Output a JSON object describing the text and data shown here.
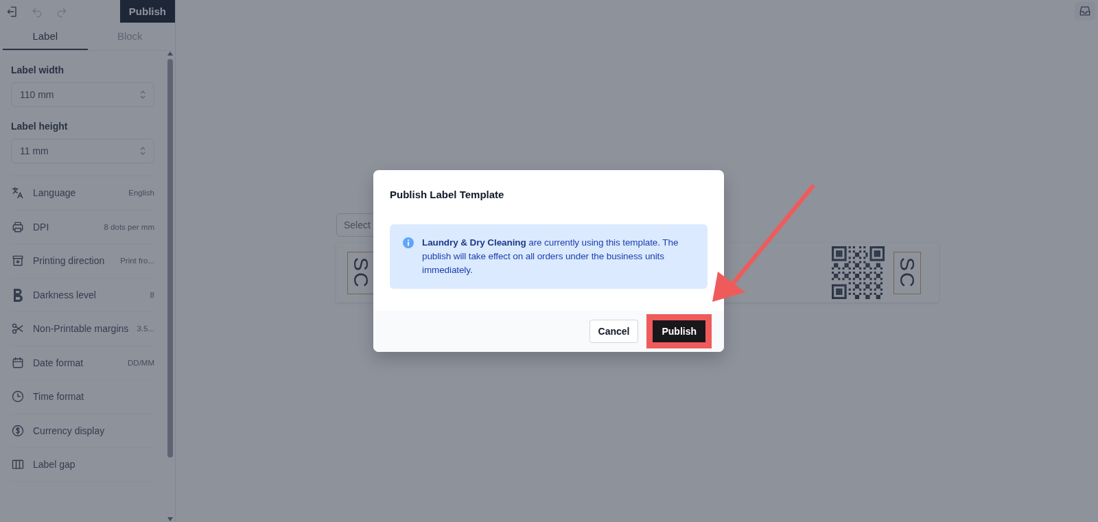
{
  "toolbar": {
    "publish_button": "Publish"
  },
  "tabs": [
    {
      "label": "Label",
      "selected": true
    },
    {
      "label": "Block",
      "selected": false
    }
  ],
  "fields": [
    {
      "label": "Label width",
      "value": "110 mm"
    },
    {
      "label": "Label height",
      "value": "11 mm"
    }
  ],
  "settings": [
    {
      "label": "Language",
      "value": "English"
    },
    {
      "label": "DPI",
      "value": "8 dots per mm"
    },
    {
      "label": "Printing direction",
      "value": "Print fro..."
    },
    {
      "label": "Darkness level",
      "value": "8"
    },
    {
      "label": "Non-Printable margins",
      "value": "3.5..."
    },
    {
      "label": "Date format",
      "value": "DD/MM"
    },
    {
      "label": "Time format"
    },
    {
      "label": "Currency display"
    },
    {
      "label": "Label gap"
    }
  ],
  "canvas": {
    "select": {
      "placeholder": "Select"
    },
    "label_blocks": [
      {
        "kind": "text",
        "text": "SC"
      },
      {
        "kind": "qr"
      },
      {
        "kind": "text",
        "text": "SC"
      }
    ]
  },
  "dialog": {
    "title": "Publish Label Template",
    "message": "**Laundry & Dry Cleaning** are currently using this template. The publish will take effect on all orders under the business units immediately.",
    "buttons": [
      {
        "label": "Cancel",
        "kind": "secondary",
        "highlighted": false
      },
      {
        "label": "Publish",
        "kind": "primary",
        "highlighted": true
      }
    ]
  }
}
